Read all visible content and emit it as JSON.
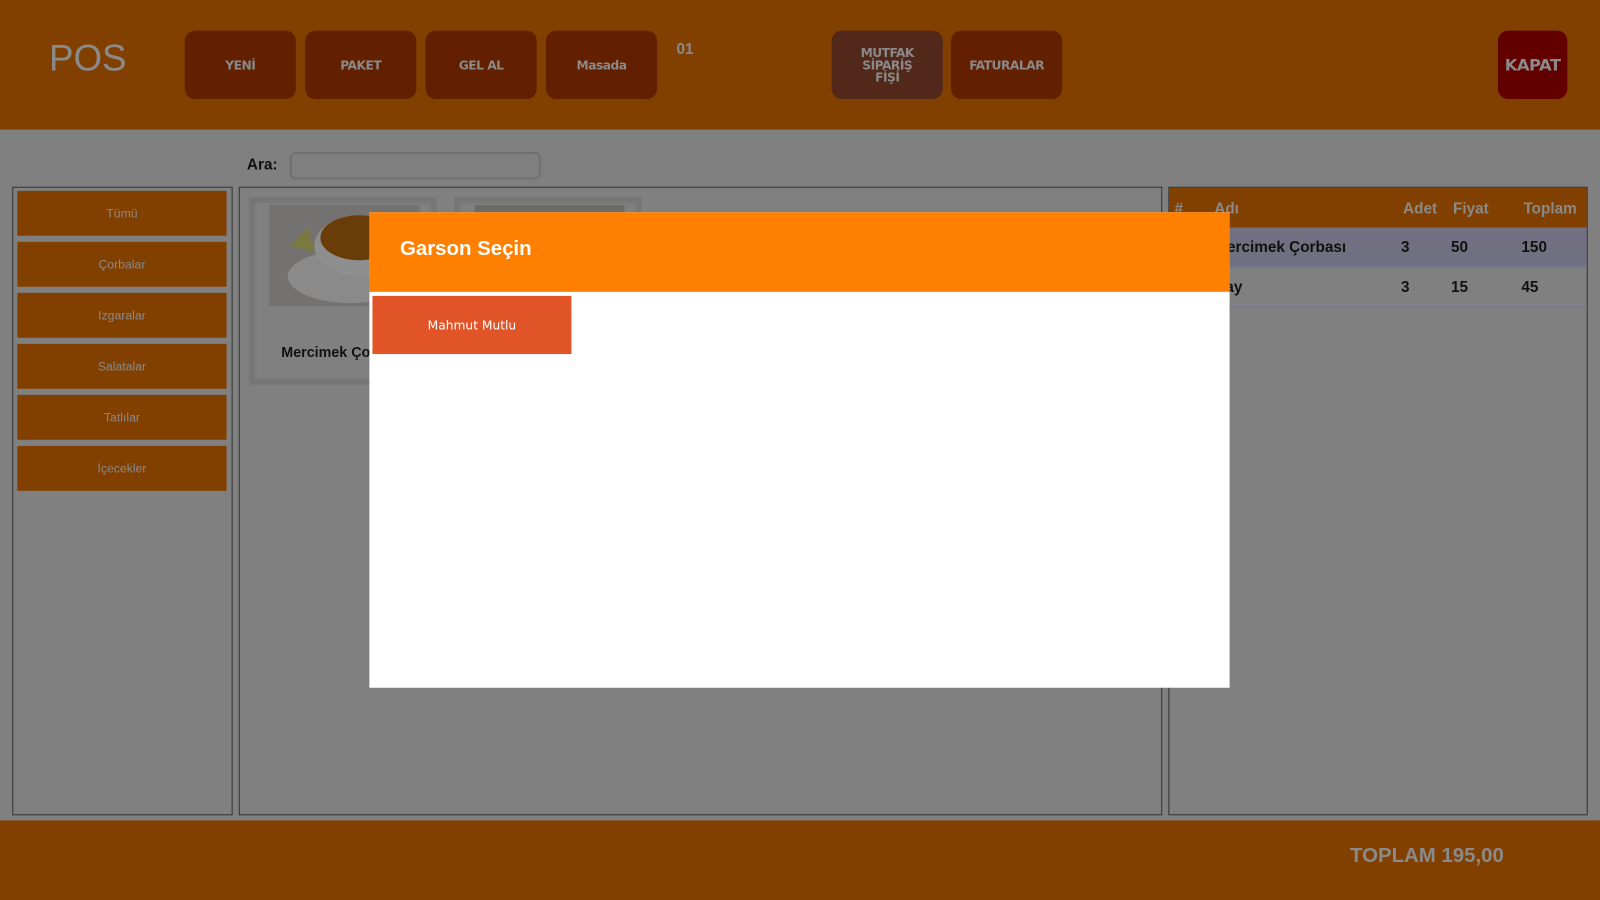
{
  "header": {
    "logo": "POS",
    "buttons": {
      "new": "YENİ",
      "package": "PAKET",
      "takeaway": "GEL AL",
      "table": "Masada",
      "kitchen": "MUTFAK SİPARİŞ FİŞİ",
      "invoices": "FATURALAR",
      "close": "KAPAT"
    },
    "order_number": "01"
  },
  "search": {
    "label": "Ara:",
    "value": ""
  },
  "categories": [
    "Tümü",
    "Çorbalar",
    "Izgaralar",
    "Salatalar",
    "Tatlılar",
    "İçecekler"
  ],
  "products": [
    {
      "name": "Mercimek Çorbası"
    },
    {
      "name": ""
    }
  ],
  "order_table": {
    "columns": [
      "#",
      "Adı",
      "Adet",
      "Fiyat",
      "Toplam"
    ],
    "rows": [
      {
        "name": "Mercimek Çorbası",
        "qty": "3",
        "price": "50",
        "total": "150"
      },
      {
        "name": "Çay",
        "qty": "3",
        "price": "15",
        "total": "45"
      }
    ]
  },
  "footer": {
    "total": "TOPLAM 195,00"
  },
  "modal": {
    "title": "Garson Seçin",
    "waiters": [
      "Mahmut Mutlu"
    ]
  },
  "colors": {
    "header": "#824000",
    "button": "#622000",
    "kapat": "#620000",
    "modal_header": "#ff8000",
    "waiter_button": "#e05428"
  }
}
